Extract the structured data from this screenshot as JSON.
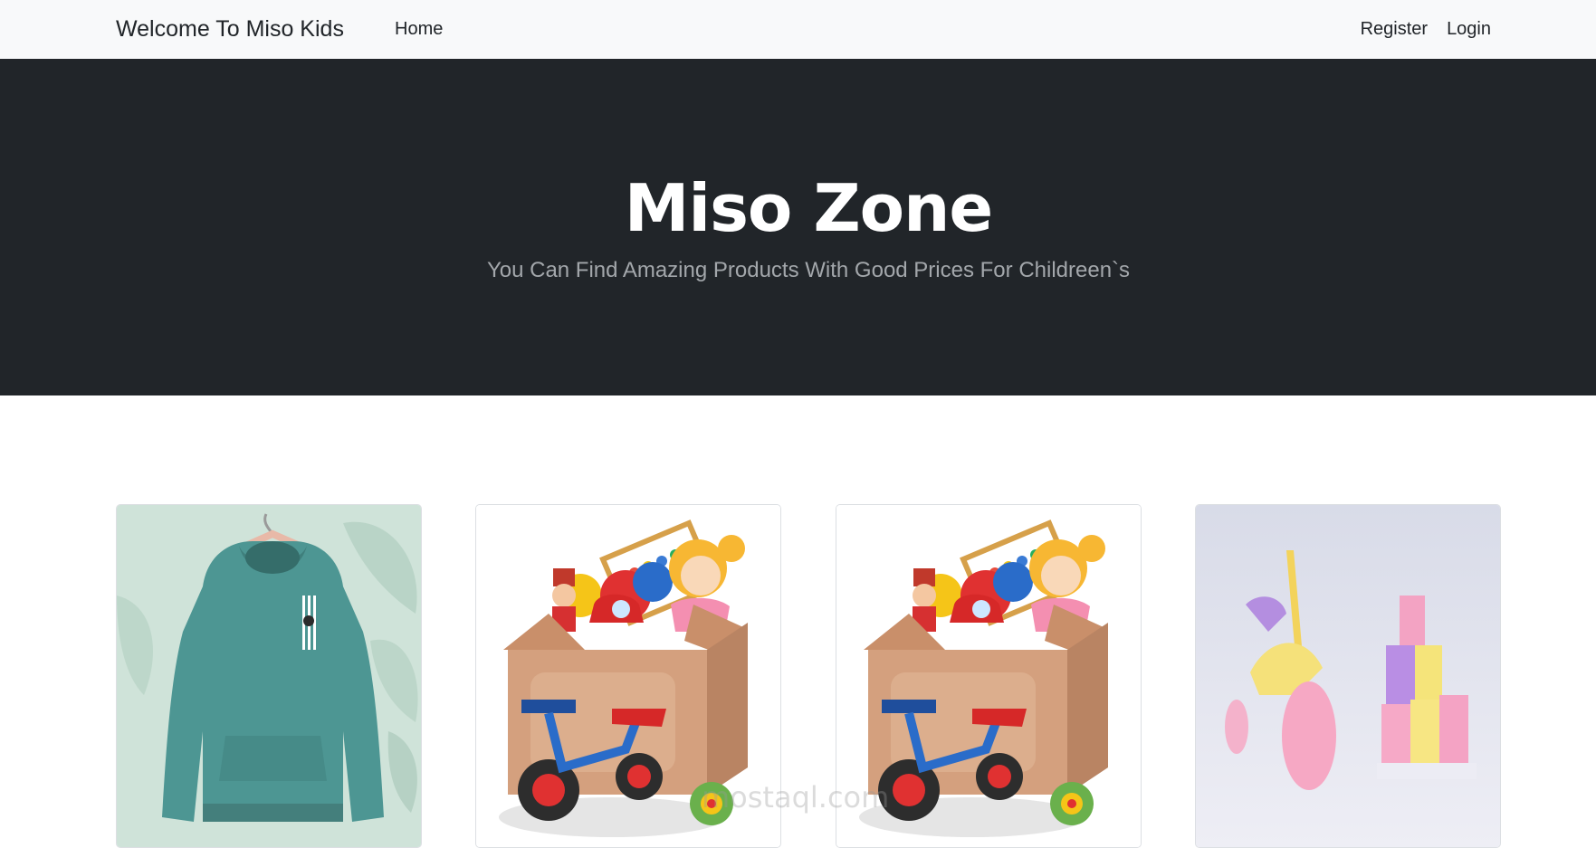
{
  "navbar": {
    "brand": "Welcome To Miso Kids",
    "home": "Home",
    "register": "Register",
    "login": "Login"
  },
  "hero": {
    "title": "Miso Zone",
    "subtitle": "You Can Find Amazing Products With Good Prices For Childreen`s"
  },
  "products": [
    {
      "image": "teal-hoodie-image"
    },
    {
      "image": "toy-box-image"
    },
    {
      "image": "toy-box-image"
    },
    {
      "image": "toy-bike-blocks-image"
    }
  ],
  "watermark": {
    "text": "mostaql.com"
  },
  "colors": {
    "navbar_bg": "#f8f9fa",
    "hero_bg": "#212529",
    "hero_title": "#ffffff",
    "hero_subtitle": "#a3a7ab"
  }
}
